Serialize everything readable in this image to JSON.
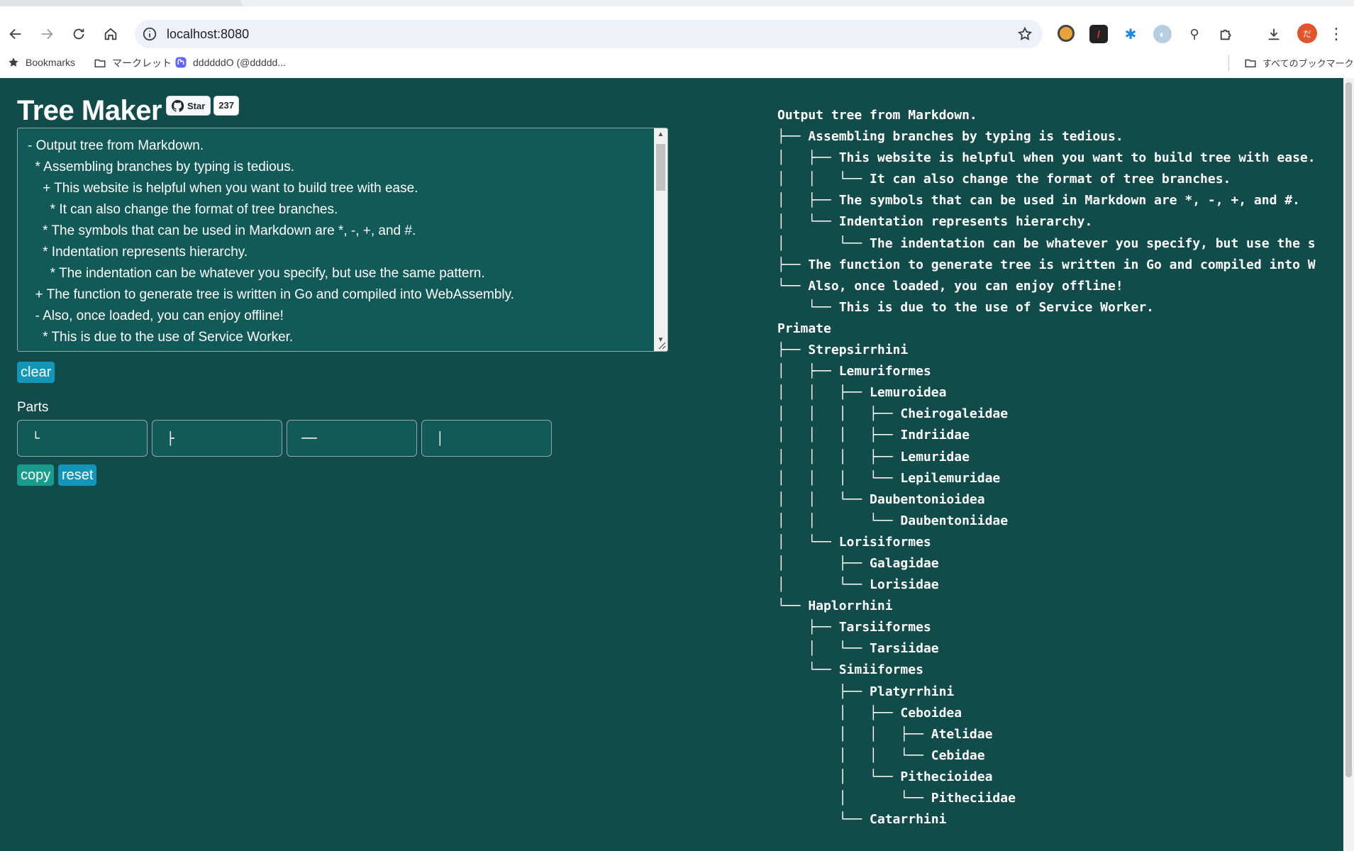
{
  "browser": {
    "url": "localhost:8080",
    "bookmarks": [
      {
        "label": "Bookmarks",
        "icon": "star-icon"
      },
      {
        "label": "マークレット",
        "icon": "folder-icon"
      },
      {
        "label": "ddddddO (@ddddd...",
        "icon": "mastodon-icon"
      }
    ],
    "all_bookmarks": "すべてのブックマーク",
    "avatar_initial": "だ"
  },
  "app": {
    "title": "Tree Maker",
    "github": {
      "star_label": "Star",
      "star_count": "237"
    },
    "editor_lines": [
      "- Output tree from Markdown.",
      "  * Assembling branches by typing is tedious.",
      "    + This website is helpful when you want to build tree with ease.",
      "      * It can also change the format of tree branches.",
      "    * The symbols that can be used in Markdown are *, -, +, and #.",
      "    * Indentation represents hierarchy.",
      "      * The indentation can be whatever you specify, but use the same pattern.",
      "  + The function to generate tree is written in Go and compiled into WebAssembly.",
      "  - Also, once loaded, you can enjoy offline!",
      "    * This is due to the use of Service Worker."
    ],
    "clear_label": "clear",
    "parts_label": "Parts",
    "parts": [
      "└",
      "├",
      "──",
      "│"
    ],
    "copy_label": "copy",
    "reset_label": "reset",
    "output_lines": [
      "Output tree from Markdown.",
      "├── Assembling branches by typing is tedious.",
      "│   ├── This website is helpful when you want to build tree with ease.",
      "│   │   └── It can also change the format of tree branches.",
      "│   ├── The symbols that can be used in Markdown are *, -, +, and #.",
      "│   └── Indentation represents hierarchy.",
      "│       └── The indentation can be whatever you specify, but use the s",
      "├── The function to generate tree is written in Go and compiled into W",
      "└── Also, once loaded, you can enjoy offline!",
      "    └── This is due to the use of Service Worker.",
      "Primate",
      "├── Strepsirrhini",
      "│   ├── Lemuriformes",
      "│   │   ├── Lemuroidea",
      "│   │   │   ├── Cheirogaleidae",
      "│   │   │   ├── Indriidae",
      "│   │   │   ├── Lemuridae",
      "│   │   │   └── Lepilemuridae",
      "│   │   └── Daubentonioidea",
      "│   │       └── Daubentoniidae",
      "│   └── Lorisiformes",
      "│       ├── Galagidae",
      "│       └── Lorisidae",
      "└── Haplorrhini",
      "    ├── Tarsiiformes",
      "    │   └── Tarsiidae",
      "    └── Simiiformes",
      "        ├── Platyrrhini",
      "        │   ├── Ceboidea",
      "        │   │   ├── Atelidae",
      "        │   │   └── Cebidae",
      "        │   └── Pithecioidea",
      "        │       └── Pitheciidae",
      "        └── Catarrhini"
    ]
  },
  "colors": {
    "page_bg": "#114b4a",
    "editor_bg": "#125a58",
    "clear_btn": "#1496b8",
    "copy_btn": "#1a9c8c",
    "reset_btn": "#1496b8"
  }
}
